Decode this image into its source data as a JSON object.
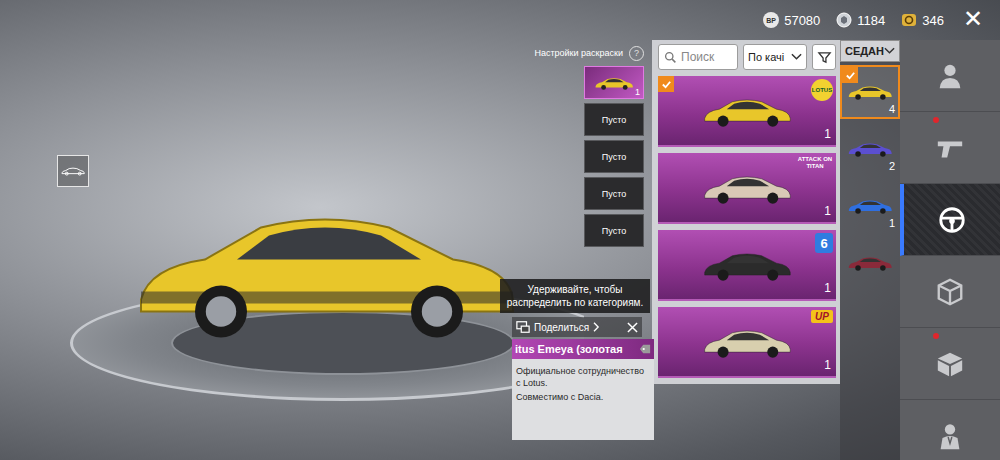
{
  "topbar": {
    "currencies": [
      {
        "kind": "bp",
        "icon_text": "BP",
        "value": "57080"
      },
      {
        "kind": "silver",
        "value": "1184"
      },
      {
        "kind": "uc",
        "value": "346"
      }
    ],
    "close": "✕"
  },
  "paint_settings": {
    "label": "Настройки раскраски",
    "help": "?",
    "slots": [
      {
        "kind": "car",
        "selected": true,
        "count": "1",
        "color": "#e8c62a"
      },
      {
        "kind": "empty",
        "selected": false,
        "label": "Пусто"
      },
      {
        "kind": "empty",
        "selected": false,
        "label": "Пусто"
      },
      {
        "kind": "empty",
        "selected": false,
        "label": "Пусто"
      },
      {
        "kind": "empty",
        "selected": false,
        "label": "Пусто"
      }
    ]
  },
  "search": {
    "placeholder": "Поиск",
    "sort": "По качі"
  },
  "skins": [
    {
      "badge": "LOTUS",
      "badge_kind": "lotus",
      "count": "1",
      "checked": true,
      "color": "#e8c62a"
    },
    {
      "badge": "ATTACK ON TITAN",
      "badge_kind": "aot",
      "count": "1",
      "checked": false,
      "color": "#d9c9b6"
    },
    {
      "badge": "6",
      "badge_kind": "six",
      "count": "1",
      "checked": false,
      "color": "#2b2b2b"
    },
    {
      "badge": "UP",
      "badge_kind": "up",
      "count": "1",
      "checked": false,
      "color": "#d8cfae"
    }
  ],
  "category": {
    "label": "СЕДАН",
    "items": [
      {
        "count": "4",
        "selected": true,
        "color": "#e8c62a"
      },
      {
        "count": "2",
        "selected": false,
        "color": "#5b4fd0"
      },
      {
        "count": "1",
        "selected": false,
        "color": "#2f6fe0"
      },
      {
        "selected": false,
        "color": "#8a2a3a"
      }
    ]
  },
  "sidebar": {
    "items": [
      {
        "kind": "person",
        "selected": false,
        "dot": false
      },
      {
        "kind": "gun",
        "selected": false,
        "dot": true
      },
      {
        "kind": "wheel",
        "selected": true,
        "dot": false
      },
      {
        "kind": "cube",
        "selected": false,
        "dot": false
      },
      {
        "kind": "box",
        "selected": false,
        "dot": true
      },
      {
        "kind": "character",
        "selected": false,
        "dot": false
      }
    ]
  },
  "tooltip": "Удерживайте, чтобы распределить по категориям.",
  "share": {
    "label": "Поделиться"
  },
  "info": {
    "title": "itus Emeya (золотая",
    "lines": [
      "Официальное сотрудничество с Lotus.",
      "Совместимо с Dacia."
    ]
  },
  "scene": {
    "car_color": "#e8c62a"
  }
}
